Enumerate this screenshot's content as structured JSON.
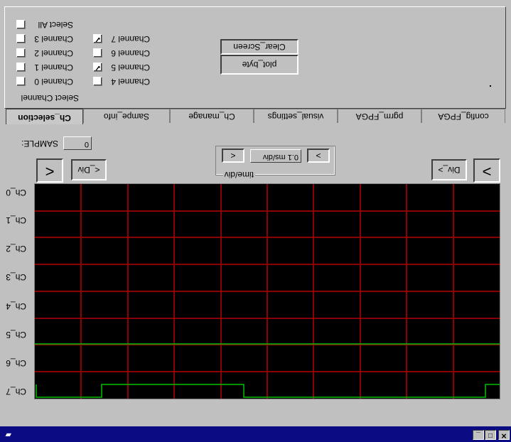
{
  "window": {
    "minimize_icon": "minimize-icon",
    "maximize_icon": "maximize-icon",
    "close_icon": "close-icon",
    "system_icon": "app-icon"
  },
  "tabs": [
    {
      "label": "Ch_selection",
      "active": true
    },
    {
      "label": "Sampe_info",
      "active": false
    },
    {
      "label": "Ch_manage",
      "active": false
    },
    {
      "label": "visual_settings",
      "active": false
    },
    {
      "label": "pgrm_FPGA",
      "active": false
    },
    {
      "label": "config_FPGA",
      "active": false
    }
  ],
  "channel_select": {
    "group_label": "Select Channel",
    "select_all": {
      "label": "Select All",
      "checked": false
    },
    "channels": [
      {
        "label": "Channel 0",
        "checked": false
      },
      {
        "label": "Channel 1",
        "checked": false
      },
      {
        "label": "Channel 2",
        "checked": false
      },
      {
        "label": "Channel 3",
        "checked": false
      },
      {
        "label": "Channel 4",
        "checked": false
      },
      {
        "label": "Channel 5",
        "checked": true
      },
      {
        "label": "Channel 6",
        "checked": false
      },
      {
        "label": "Channel 7",
        "checked": true
      }
    ]
  },
  "actions": {
    "plot_bytes": "plot_byte",
    "clear_screen": "Clear_Screen"
  },
  "sample": {
    "label": "SAMPLE:",
    "value": "0"
  },
  "timebase": {
    "label": "time/div",
    "value": "0.1 ms/div",
    "dec": "<",
    "inc": ">"
  },
  "nav": {
    "prev": "<",
    "prev_div": "<_Div",
    "next_div": "Div_>",
    "next": ">"
  },
  "scope": {
    "channel_labels": [
      "Ch_0",
      "Ch_1",
      "Ch_2",
      "Ch_3",
      "Ch_4",
      "Ch_5",
      "Ch_6",
      "Ch_7"
    ],
    "grid_color": "#8b0000",
    "trace_color": "#00c000",
    "background": "#000000"
  }
}
